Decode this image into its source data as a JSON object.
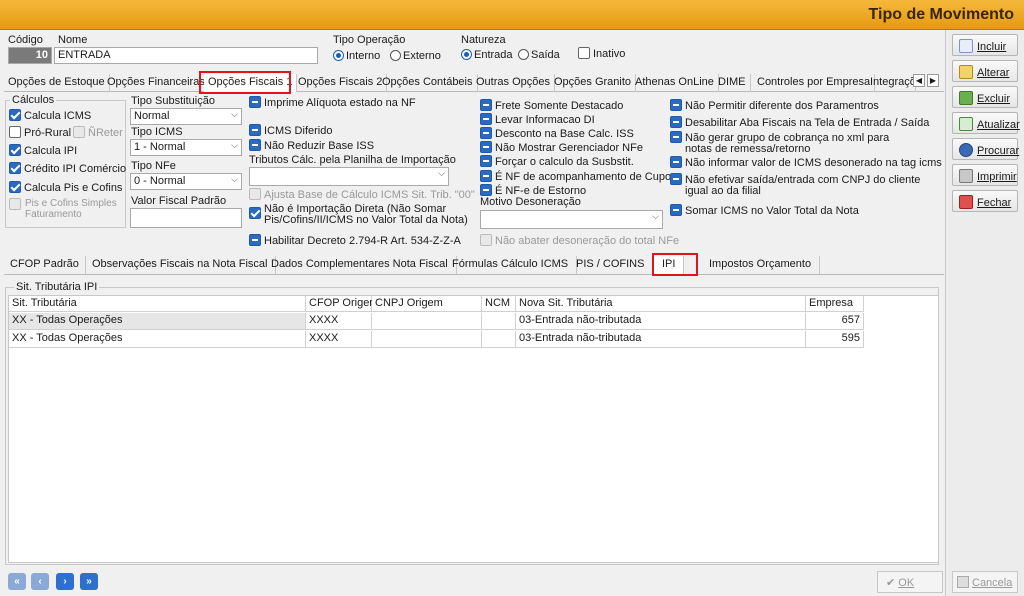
{
  "window": {
    "title": "Tipo de Movimento"
  },
  "header": {
    "codigo_label": "Código",
    "nome_label": "Nome",
    "codigo_value": "10",
    "nome_value": "ENTRADA",
    "tipo_operacao_label": "Tipo Operação",
    "interno": "Interno",
    "externo": "Externo",
    "natureza_label": "Natureza",
    "entrada": "Entrada",
    "saida": "Saída",
    "inativo": "Inativo"
  },
  "top_tabs": [
    "Opções de Estoque",
    "Opções Financeiras",
    "Opções Fiscais 1",
    "Opções Fiscais 2",
    "Opções Contábeis",
    "Outras Opções",
    "Opções Granito",
    "Athenas OnLine",
    "DIME",
    "Controles por Empresa",
    "Integraçõ"
  ],
  "calculos": {
    "title": "Cálculos",
    "calcula_icms": "Calcula ICMS",
    "pro_rural": "Pró-Rural",
    "n_reter": "ÑReter",
    "calcula_ipi": "Calcula IPI",
    "credito_ipi": "Crédito IPI Comércio",
    "calcula_pis": "Calcula Pis e Cofins",
    "pis_simples": "Pis e Cofins Simples Faturamento"
  },
  "col2": {
    "tipo_substituicao_label": "Tipo Substituição",
    "tipo_substituicao_value": "Normal",
    "tipo_icms_label": "Tipo ICMS",
    "tipo_icms_value": "1 - Normal",
    "tipo_nfe_label": "Tipo NFe",
    "tipo_nfe_value": "0 - Normal",
    "valor_fiscal_label": "Valor Fiscal Padrão"
  },
  "col3": {
    "imprime_aliquota": "Imprime Alíquota estado na NF",
    "icms_diferido": "ICMS Diferido",
    "nao_reduzir_iss": "Não Reduzir Base ISS",
    "tributos_label": "Tributos Cálc. pela Planilha de Importação",
    "ajusta_base": "Ajusta Base de Cálculo ICMS Sit. Trib. \"00\"",
    "nao_importacao": "Não é Importação Direta (Não Somar Pis/Cofins/II/ICMS  no Valor Total da Nota)",
    "habilitar_decreto": "Habilitar Decreto 2.794-R Art. 534-Z-Z-A"
  },
  "col4": {
    "frete": "Frete Somente Destacado",
    "levar_info": "Levar Informacao DI",
    "desconto_iss": "Desconto na Base Calc. ISS",
    "nao_mostrar": "Não Mostrar Gerenciador NFe",
    "forcar": "Forçar o calculo da Susbstit.",
    "nf_cupom": "É NF de acompanhamento de Cupom",
    "nfe_estorno": "É NF-e de Estorno",
    "motivo_label": "Motivo Desoneração",
    "nao_abater": "Não abater desoneração do total NFe"
  },
  "col5": {
    "nao_permitir": "Não Permitir diferente dos Paramentros",
    "desabilitar": "Desabilitar Aba Fiscais na Tela de Entrada / Saída",
    "nao_gerar_1": "Não gerar grupo de cobrança no xml para",
    "nao_gerar_2": "notas de remessa/retorno",
    "nao_informar": "Não informar valor de ICMS desonerado na tag icms",
    "nao_efetivar_1": "Não efetivar saída/entrada com CNPJ do cliente",
    "nao_efetivar_2": "igual ao da filial",
    "somar_icms": "Somar ICMS no Valor Total da Nota"
  },
  "bottom_tabs": [
    "CFOP Padrão",
    "Observações Fiscais na Nota Fiscal",
    "Dados Complementares Nota Fiscal",
    "Fórmulas Cálculo ICMS",
    "PIS / COFINS",
    "IPI",
    "Impostos Orçamento"
  ],
  "ipi_group_title": "Sit. Tributária IPI",
  "grid": {
    "headers": [
      "Sit. Tributária",
      "CFOP Origem",
      "CNPJ Origem",
      "NCM",
      "Nova Sit. Tributária",
      "Empresa"
    ],
    "rows": [
      [
        "XX - Todas Operações",
        "XXXX",
        "",
        "",
        "03-Entrada não-tributada",
        "657"
      ],
      [
        "XX - Todas Operações",
        "XXXX",
        "",
        "",
        "03-Entrada não-tributada",
        "595"
      ]
    ]
  },
  "side_buttons": [
    "Incluir",
    "Alterar",
    "Excluir",
    "Atualizar",
    "Procurar",
    "Imprimir",
    "Fechar"
  ],
  "footer": {
    "ok": "OK",
    "cancela": "Cancela"
  },
  "colors": {
    "title_bar": "#e59a12",
    "highlight": "#e0141c",
    "check_blue": "#2a6ac0"
  }
}
